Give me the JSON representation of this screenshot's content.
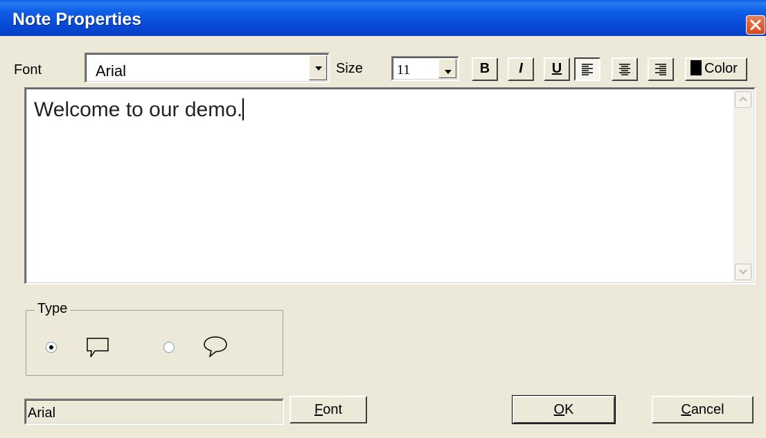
{
  "window": {
    "title": "Note Properties"
  },
  "toolbar": {
    "font_label": "Font",
    "font_value": "Arial",
    "size_label": "Size",
    "size_value": "11",
    "bold_label": "B",
    "italic_label": "I",
    "underline_label": "U",
    "color_label": "Color",
    "color_swatch": "#000000"
  },
  "editor": {
    "text": "Welcome to our demo."
  },
  "type_group": {
    "label": "Type",
    "options": [
      {
        "icon": "rectangle-callout-icon",
        "selected": true
      },
      {
        "icon": "rounded-speech-bubble-icon",
        "selected": false
      }
    ]
  },
  "footer": {
    "font_display": "Arial",
    "font_button": {
      "mnemonic": "F",
      "rest": "ont"
    },
    "ok_button": {
      "mnemonic": "O",
      "rest": "K"
    },
    "cancel_button": {
      "mnemonic": "C",
      "rest": "ancel"
    }
  }
}
